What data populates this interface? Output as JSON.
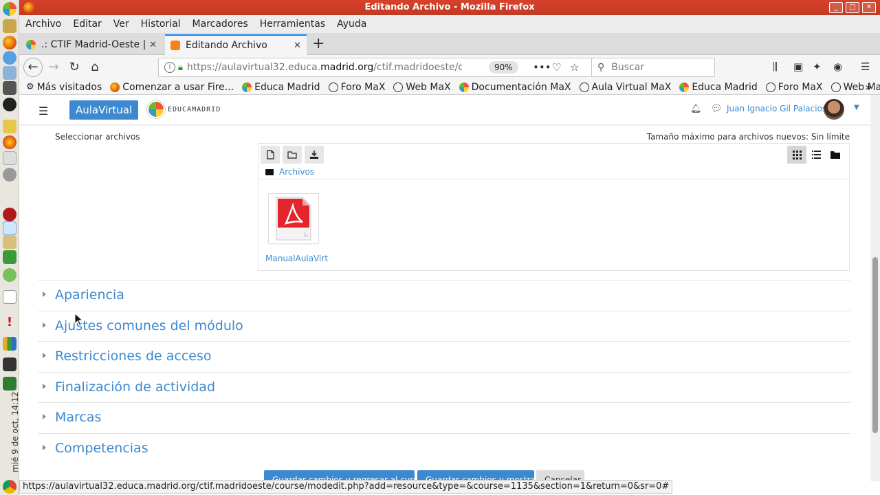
{
  "window": {
    "title": "Editando Archivo - Mozilla Firefox"
  },
  "dock": {
    "clock": "mié 9 de oct, 14:12"
  },
  "menu": [
    "Archivo",
    "Editar",
    "Ver",
    "Historial",
    "Marcadores",
    "Herramientas",
    "Ayuda"
  ],
  "tabs": [
    {
      "label": ".: CTIF Madrid-Oeste | N",
      "active": false
    },
    {
      "label": "Editando Archivo",
      "active": true
    }
  ],
  "nav": {
    "url_prefix": "https://aulavirtual32.educa.",
    "url_domain": "madrid.org",
    "url_suffix": "/ctif.madridoeste/cour",
    "zoom": "90%",
    "search_placeholder": "Buscar"
  },
  "bookmarks": [
    {
      "label": "Más visitados",
      "icon": "gear-icon"
    },
    {
      "label": "Comenzar a usar Fire...",
      "icon": "firefox-icon"
    },
    {
      "label": "Educa Madrid",
      "icon": "educamadrid-icon"
    },
    {
      "label": "Foro MaX",
      "icon": "globe-icon"
    },
    {
      "label": "Web MaX",
      "icon": "globe-icon"
    },
    {
      "label": "Documentación MaX",
      "icon": "educamadrid-icon"
    },
    {
      "label": "Aula Virtual MaX",
      "icon": "globe-icon"
    },
    {
      "label": "Educa Madrid",
      "icon": "educamadrid-icon"
    },
    {
      "label": "Foro MaX",
      "icon": "globe-icon"
    },
    {
      "label": "Web MaX",
      "icon": "globe-icon"
    }
  ],
  "moodle": {
    "brand_button": "AulaVirtual",
    "logo_text": "EDUCAMADRID",
    "user_name": "Juan Ignacio Gil Palacios"
  },
  "filepicker": {
    "label": "Seleccionar archivos",
    "max_size": "Tamaño máximo para archivos nuevos: Sin límite",
    "path": "Archivos",
    "file_name": "ManualAulaVirt"
  },
  "sections": [
    "Apariencia",
    "Ajustes comunes del módulo",
    "Restricciones de acceso",
    "Finalización de actividad",
    "Marcas",
    "Competencias"
  ],
  "footer_buttons": [
    "Guardar cambios y regresar al curso",
    "Guardar cambios y mostrar",
    "Cancelar"
  ],
  "status_url": "https://aulavirtual32.educa.madrid.org/ctif.madridoeste/course/modedit.php?add=resource&type=&course=1135&section=1&return=0&sr=0#",
  "colors": {
    "accent": "#3c89d0",
    "titlebar": "#c8402a",
    "tab_active_border": "#0a84ff"
  }
}
